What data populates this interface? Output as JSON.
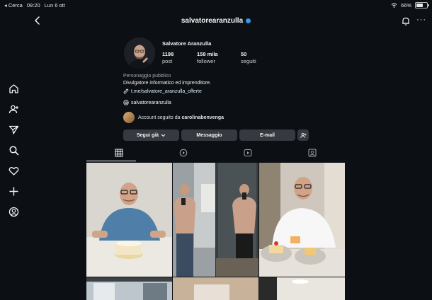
{
  "status_bar": {
    "back_label": "◂ Cerca",
    "time": "09:20",
    "date": "Lun 6 ott",
    "battery": "66%"
  },
  "header": {
    "username": "salvatorearanzulla",
    "verified": true
  },
  "profile": {
    "name": "Salvatore Aranzulla",
    "stats": [
      {
        "value": "1198",
        "label": "post"
      },
      {
        "value": "158 mila",
        "label": "follower"
      },
      {
        "value": "50",
        "label": "seguiti"
      }
    ],
    "category": "Personaggio pubblico",
    "bio": "Divulgatore informatico ed imprenditore.",
    "link": "t.me/salvatore_aranzulla_offerte",
    "threads_handle": "salvatorearanzulla",
    "followed_by_prefix": "Account seguito da ",
    "followed_by_user": "carolinabenvenga"
  },
  "actions": {
    "following": "Segui già",
    "message": "Messaggio",
    "email": "E-mail"
  },
  "tabs": [
    "grid",
    "reels",
    "video",
    "tagged"
  ],
  "icons": {
    "nav": [
      "home-icon",
      "add-user-icon",
      "send-icon",
      "search-icon",
      "heart-icon",
      "plus-icon",
      "profile-icon"
    ]
  },
  "colors": {
    "background": "#0c1014",
    "verified": "#3797f0",
    "button": "#363a40",
    "link": "#e0f1ff"
  }
}
